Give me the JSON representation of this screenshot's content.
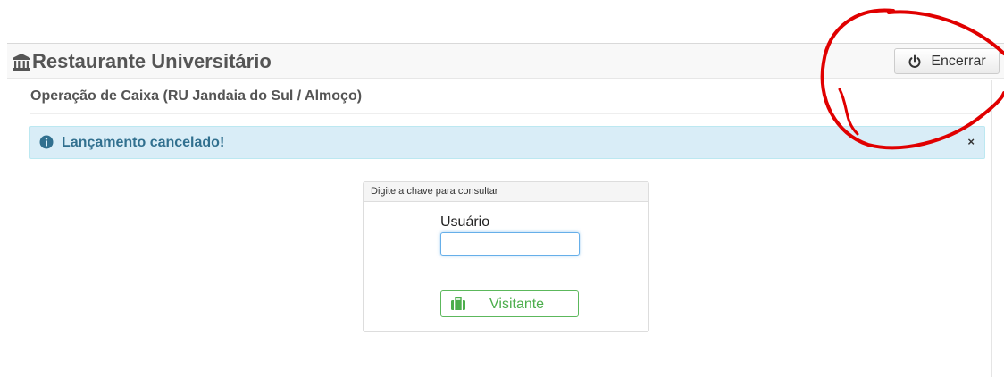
{
  "navbar": {
    "brand_icon": "university-icon",
    "brand_title": "Restaurante Universitário",
    "logout_icon": "power-icon",
    "logout_label": "Encerrar"
  },
  "page": {
    "header": "Operação de Caixa (RU Jandaia do Sul / Almoço)"
  },
  "alert": {
    "icon": "info-circle-icon",
    "message": "Lançamento cancelado!",
    "close_label": "×"
  },
  "search": {
    "heading": "Digite a chave para consultar",
    "user_label": "Usuário",
    "user_value": "",
    "visitor_icon": "briefcase-icon",
    "visitor_label": "Visitante"
  },
  "colors": {
    "alert_bg": "#d9edf7",
    "alert_text": "#31708f",
    "success_green": "#5cb85c",
    "annotation_red": "#e00000"
  }
}
